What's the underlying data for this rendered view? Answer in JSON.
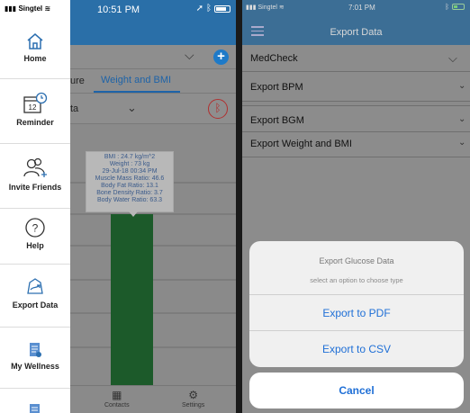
{
  "left_phone": {
    "status": {
      "carrier": "Singtel",
      "time": "10:51 PM"
    },
    "tabs": {
      "partial_label": "ure",
      "active_label": "Weight and BMI"
    },
    "select_partial": "ta",
    "tooltip": {
      "lines": [
        "BMI : 24.7 kg/m^2",
        "Weight : 73 kg",
        "29-Jul-18 00:34 PM",
        "Muscle Mass Ratio: 46.6",
        "Body Fat Ratio: 13.1",
        "Bone Density Ratio: 3.7",
        "Body Water Ratio: 63.3"
      ]
    },
    "bar_color": "#1c5a2a",
    "sidebar": {
      "items": [
        {
          "label": "Home",
          "icon": "home-icon"
        },
        {
          "label": "Reminder",
          "icon": "calendar-clock-icon",
          "icon_text": "12"
        },
        {
          "label": "Invite Friends",
          "icon": "invite-friends-icon"
        },
        {
          "label": "Help",
          "icon": "help-icon",
          "icon_text": "?"
        },
        {
          "label": "Export Data",
          "icon": "export-icon"
        },
        {
          "label": "My Wellness",
          "icon": "wellness-icon"
        }
      ]
    },
    "bottom_bar": {
      "contacts_label": "Contacts",
      "settings_label": "Settings"
    }
  },
  "right_phone": {
    "status": {
      "carrier": "Singtel",
      "time": "7:01 PM"
    },
    "header_title": "Export Data",
    "rows": [
      {
        "label": "MedCheck"
      },
      {
        "label": "Export BPM"
      },
      {
        "label": "Export BGM"
      },
      {
        "label": "Export Weight and BMI"
      }
    ],
    "action_sheet": {
      "title": "Export Glucose Data",
      "subtitle": "select an option to choose type",
      "pdf_label": "Export to PDF",
      "csv_label": "Export to CSV",
      "cancel_label": "Cancel"
    },
    "accent_color": "#1f6fd6"
  }
}
